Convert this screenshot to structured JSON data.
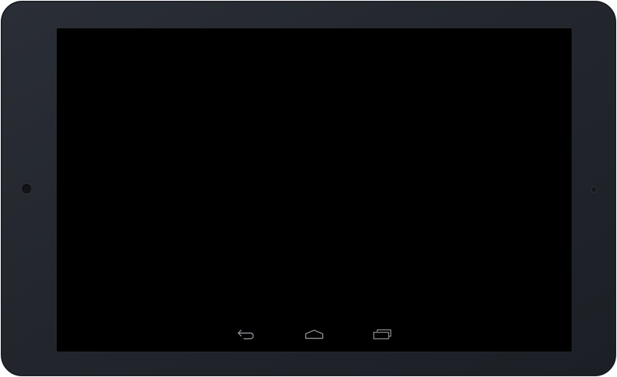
{
  "device": {
    "frame_color": "#23262d",
    "screen_color": "#000000"
  },
  "navigation": {
    "icon_color": "#8a8d92",
    "buttons": [
      {
        "name": "back",
        "icon": "back-arrow-icon"
      },
      {
        "name": "home",
        "icon": "home-icon"
      },
      {
        "name": "recents",
        "icon": "recent-apps-icon"
      }
    ]
  }
}
